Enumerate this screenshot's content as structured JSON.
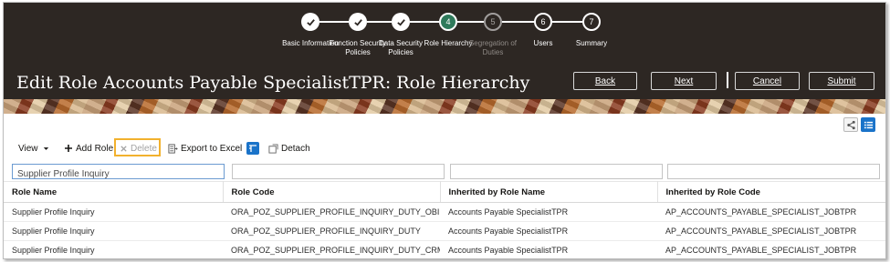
{
  "train": {
    "steps": [
      {
        "number": "1",
        "label": "Basic Information",
        "state": "done"
      },
      {
        "number": "2",
        "label": "Function Security Policies",
        "state": "done"
      },
      {
        "number": "3",
        "label": "Data Security Policies",
        "state": "done"
      },
      {
        "number": "4",
        "label": "Role Hierarchy",
        "state": "current"
      },
      {
        "number": "5",
        "label": "Segregation of Duties",
        "state": "future"
      },
      {
        "number": "6",
        "label": "Users",
        "state": "future"
      },
      {
        "number": "7",
        "label": "Summary",
        "state": "future"
      }
    ]
  },
  "header": {
    "title": "Edit Role Accounts Payable SpecialistTPR: Role Hierarchy",
    "back_label": "Back",
    "next_label": "Next",
    "cancel_label": "Cancel",
    "submit_label": "Submit"
  },
  "toolbar": {
    "view_label": "View",
    "add_role_label": "Add Role",
    "delete_label": "Delete",
    "export_label": "Export to Excel",
    "detach_label": "Detach"
  },
  "filters": {
    "role_name_value": "Supplier Profile Inquiry",
    "role_code_value": "",
    "inherited_name_value": "",
    "inherited_code_value": ""
  },
  "table": {
    "columns": [
      "Role Name",
      "Role Code",
      "Inherited by Role Name",
      "Inherited by Role Code"
    ],
    "rows": [
      [
        "Supplier Profile Inquiry",
        "ORA_POZ_SUPPLIER_PROFILE_INQUIRY_DUTY_OBI",
        "Accounts Payable SpecialistTPR",
        "AP_ACCOUNTS_PAYABLE_SPECIALIST_JOBTPR"
      ],
      [
        "Supplier Profile Inquiry",
        "ORA_POZ_SUPPLIER_PROFILE_INQUIRY_DUTY",
        "Accounts Payable SpecialistTPR",
        "AP_ACCOUNTS_PAYABLE_SPECIALIST_JOBTPR"
      ],
      [
        "Supplier Profile Inquiry",
        "ORA_POZ_SUPPLIER_PROFILE_INQUIRY_DUTY_CRM",
        "Accounts Payable SpecialistTPR",
        "AP_ACCOUNTS_PAYABLE_SPECIALIST_JOBTPR"
      ]
    ]
  },
  "colors": {
    "header_bg": "#2d2723",
    "current_step": "#2f7a5b",
    "highlight": "#f2b12d",
    "accent_blue": "#1a73c9"
  },
  "icons": {
    "done_step": "check-icon",
    "hierarchy_view": "hierarchy-view-icon",
    "list_view": "list-view-icon",
    "add": "plus-icon",
    "delete": "x-icon",
    "export": "excel-icon",
    "freeze": "freeze-icon",
    "detach": "detach-icon"
  }
}
